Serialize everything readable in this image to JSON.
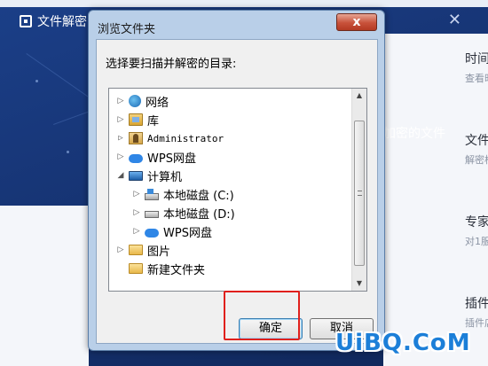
{
  "background_app": {
    "title": "文件解密",
    "close_glyph": "✕",
    "right_items": [
      {
        "label": "时间",
        "sub": "查看时"
      },
      {
        "label": "文件",
        "sub": "解密核"
      },
      {
        "label": "专家",
        "sub": "对1服"
      },
      {
        "label": "插件",
        "sub": "插件店"
      }
    ],
    "mid_text": "加密的文件"
  },
  "dialog": {
    "title": "浏览文件夹",
    "close_glyph": "x",
    "prompt": "选择要扫描并解密的目录:",
    "tree": [
      {
        "label": "网络",
        "icon": "network-globe-icon",
        "expander": "▷"
      },
      {
        "label": "库",
        "icon": "library-icon",
        "expander": "▷"
      },
      {
        "label": "Administrator",
        "icon": "user-folder-icon",
        "expander": "▷"
      },
      {
        "label": "WPS网盘",
        "icon": "cloud-icon",
        "expander": "▷"
      },
      {
        "label": "计算机",
        "icon": "computer-icon",
        "expander": "◢"
      },
      {
        "label": "本地磁盘 (C:)",
        "icon": "drive-c-icon",
        "expander": "▷"
      },
      {
        "label": "本地磁盘 (D:)",
        "icon": "drive-d-icon",
        "expander": "▷"
      },
      {
        "label": "WPS网盘",
        "icon": "cloud-icon",
        "expander": "▷"
      },
      {
        "label": "图片",
        "icon": "folder-icon",
        "expander": "▷"
      },
      {
        "label": "新建文件夹",
        "icon": "folder-icon",
        "expander": ""
      }
    ],
    "scroll_up_glyph": "▲",
    "scroll_down_glyph": "▼",
    "ok_label": "确定",
    "cancel_label": "取消"
  },
  "watermark": "UiBQ.CoM",
  "colors": {
    "app_blue": "#1b3f88",
    "dialog_frame": "#b9cfe8",
    "close_red": "#c8513a",
    "highlight_red": "#e0201c",
    "watermark_blue": "#1c7fd8"
  }
}
